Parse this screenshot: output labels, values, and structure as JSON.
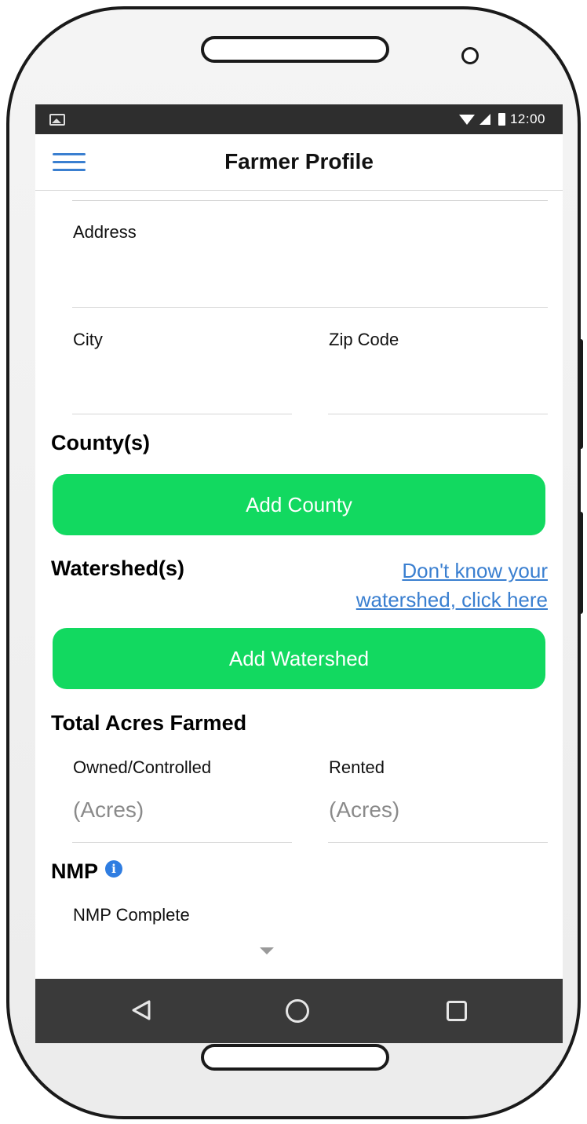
{
  "status_bar": {
    "time": "12:00",
    "icons": [
      "image-icon",
      "wifi-icon",
      "signal-icon",
      "battery-icon"
    ]
  },
  "app_bar": {
    "title": "Farmer Profile",
    "menu_icon": "hamburger-menu-icon"
  },
  "address": {
    "label": "Address"
  },
  "city": {
    "label": "City"
  },
  "zip": {
    "label": "Zip Code"
  },
  "counties": {
    "title": "County(s)",
    "button_label": "Add County"
  },
  "watersheds": {
    "title": "Watershed(s)",
    "help_link_line1": "Don't know your",
    "help_link_line2": "watershed, click here",
    "button_label": "Add Watershed"
  },
  "acres": {
    "title": "Total Acres Farmed",
    "owned_label": "Owned/Controlled",
    "owned_placeholder": "(Acres)",
    "rented_label": "Rented",
    "rented_placeholder": "(Acres)"
  },
  "nmp": {
    "title": "NMP",
    "info_icon": "i",
    "complete_label": "NMP Complete"
  },
  "nav_bar": {
    "icons": [
      "back-icon",
      "home-icon",
      "recents-icon"
    ]
  },
  "colors": {
    "accent_green": "#12d960",
    "link_blue": "#3a7fd0",
    "info_blue": "#2f7de1",
    "status_bar": "#2e2e2e",
    "nav_bar": "#3a3a3a"
  }
}
